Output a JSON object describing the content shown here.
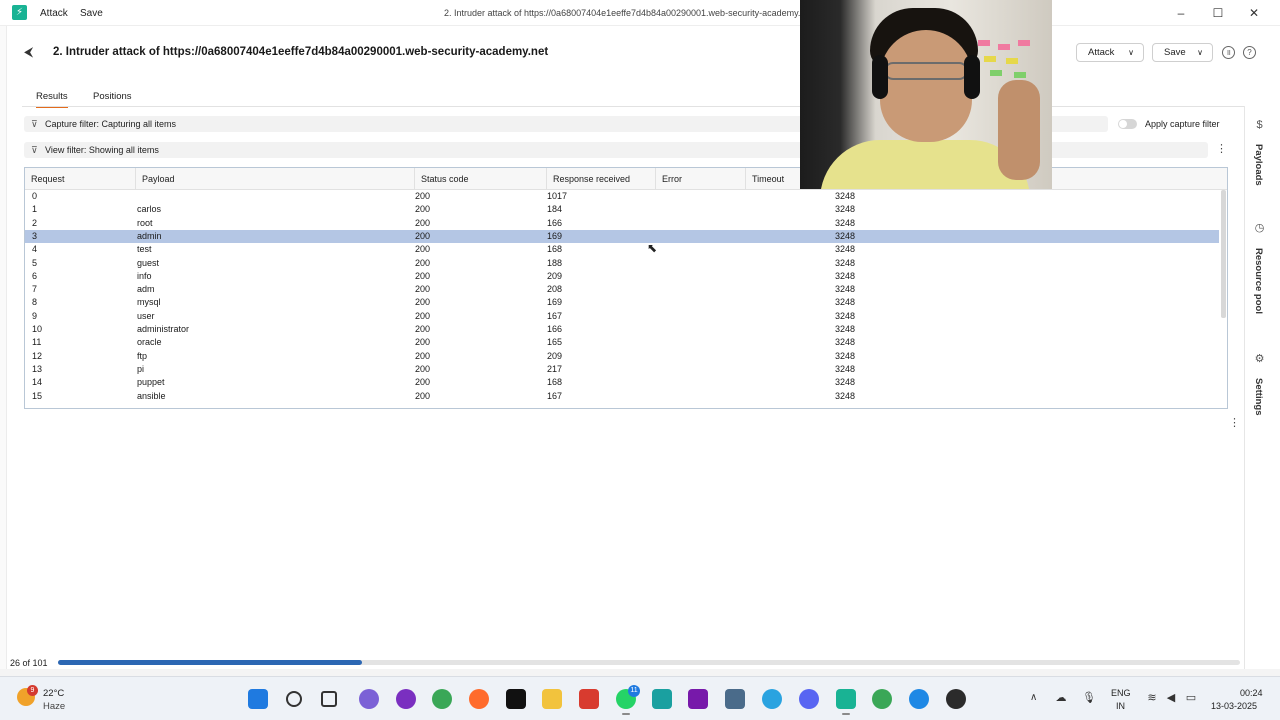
{
  "menu": {
    "attack": "Attack",
    "save": "Save"
  },
  "window": {
    "title": "2. Intruder attack of https://0a68007404e1eeffe7d4b84a00290001.web-security-academy.net"
  },
  "header": {
    "heading": "2. Intruder attack of https://0a68007404e1eeffe7d4b84a00290001.web-security-academy.net",
    "attack_button": "Attack",
    "save_button": "Save"
  },
  "tabs": [
    {
      "label": "Results",
      "active": true
    },
    {
      "label": "Positions",
      "active": false
    }
  ],
  "filters": {
    "capture": "Capture filter: Capturing all items",
    "view": "View filter: Showing all items",
    "apply_capture_label": "Apply capture filter",
    "apply_capture_enabled": false
  },
  "table": {
    "columns": [
      "Request",
      "Payload",
      "Status code",
      "Response received",
      "Error",
      "Timeout"
    ],
    "rows": [
      {
        "request": "0",
        "payload": "",
        "status": "200",
        "response": "1017",
        "length": "3248"
      },
      {
        "request": "1",
        "payload": "carlos",
        "status": "200",
        "response": "184",
        "length": "3248"
      },
      {
        "request": "2",
        "payload": "root",
        "status": "200",
        "response": "166",
        "length": "3248"
      },
      {
        "request": "3",
        "payload": "admin",
        "status": "200",
        "response": "169",
        "length": "3248",
        "selected": true
      },
      {
        "request": "4",
        "payload": "test",
        "status": "200",
        "response": "168",
        "length": "3248"
      },
      {
        "request": "5",
        "payload": "guest",
        "status": "200",
        "response": "188",
        "length": "3248"
      },
      {
        "request": "6",
        "payload": "info",
        "status": "200",
        "response": "209",
        "length": "3248"
      },
      {
        "request": "7",
        "payload": "adm",
        "status": "200",
        "response": "208",
        "length": "3248"
      },
      {
        "request": "8",
        "payload": "mysql",
        "status": "200",
        "response": "169",
        "length": "3248"
      },
      {
        "request": "9",
        "payload": "user",
        "status": "200",
        "response": "167",
        "length": "3248"
      },
      {
        "request": "10",
        "payload": "administrator",
        "status": "200",
        "response": "166",
        "length": "3248"
      },
      {
        "request": "11",
        "payload": "oracle",
        "status": "200",
        "response": "165",
        "length": "3248"
      },
      {
        "request": "12",
        "payload": "ftp",
        "status": "200",
        "response": "209",
        "length": "3248"
      },
      {
        "request": "13",
        "payload": "pi",
        "status": "200",
        "response": "217",
        "length": "3248"
      },
      {
        "request": "14",
        "payload": "puppet",
        "status": "200",
        "response": "168",
        "length": "3248"
      },
      {
        "request": "15",
        "payload": "ansible",
        "status": "200",
        "response": "167",
        "length": "3248"
      }
    ]
  },
  "side_panel": {
    "payloads": "Payloads",
    "resource_pool": "Resource pool",
    "settings": "Settings"
  },
  "progress": {
    "label": "26 of 101",
    "completed": 26,
    "total": 101
  },
  "colors": {
    "accent": "#e36b1c",
    "selection": "#b4c6e4",
    "progress": "#2c67b3",
    "logo": "#19b394"
  },
  "taskbar": {
    "weather_temp": "22°C",
    "weather_desc": "Haze",
    "weather_badge": "9",
    "language_line1": "ENG",
    "language_line2": "IN",
    "time": "00:24",
    "date": "13-03-2025",
    "apps": [
      {
        "name": "windows-start",
        "color": "#1f7ae0"
      },
      {
        "name": "search",
        "color": "#333333"
      },
      {
        "name": "task-view",
        "color": "#333333"
      },
      {
        "name": "copilot",
        "color": "#7b61d6"
      },
      {
        "name": "tor-browser",
        "color": "#7a2fc0"
      },
      {
        "name": "chrome",
        "color": "#3aa757"
      },
      {
        "name": "firefox",
        "color": "#ff6b2c"
      },
      {
        "name": "notion",
        "color": "#111111"
      },
      {
        "name": "file-explorer",
        "color": "#f2c33d"
      },
      {
        "name": "red-app",
        "color": "#d83b2f"
      },
      {
        "name": "whatsapp",
        "color": "#25d366"
      },
      {
        "name": "snipping-tool",
        "color": "#1aa0a0"
      },
      {
        "name": "onenote",
        "color": "#7719aa"
      },
      {
        "name": "calculator",
        "color": "#4a6b8a"
      },
      {
        "name": "telegram",
        "color": "#2aa3e0"
      },
      {
        "name": "discord",
        "color": "#5865f2"
      },
      {
        "name": "burp-suite",
        "color": "#19b394"
      },
      {
        "name": "chrome-profile",
        "color": "#3aa757"
      },
      {
        "name": "chrome-beta",
        "color": "#1e88e5"
      },
      {
        "name": "obs-studio",
        "color": "#2b2b2b"
      }
    ],
    "whatsapp_badge": "11"
  }
}
